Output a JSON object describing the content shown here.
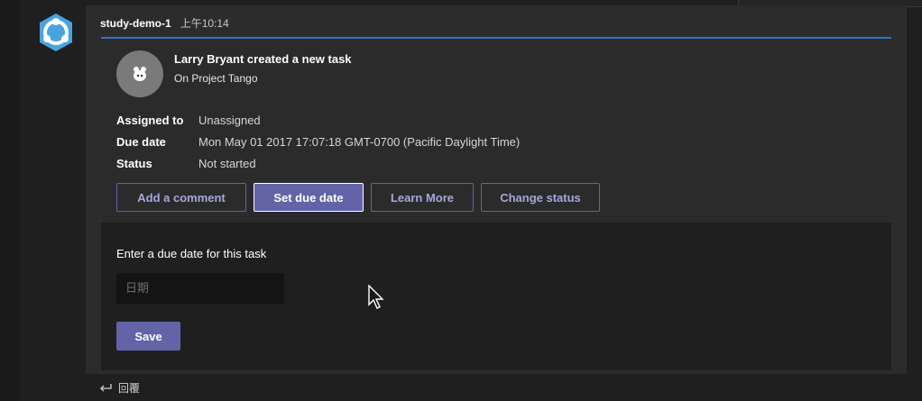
{
  "message": {
    "sender": "study-demo-1",
    "time": "上午10:14"
  },
  "card": {
    "title": "Larry Bryant created a new task",
    "subtitle": "On Project Tango",
    "facts": [
      {
        "label": "Assigned to",
        "value": "Unassigned"
      },
      {
        "label": "Due date",
        "value": "Mon May 01 2017 17:07:18 GMT-0700 (Pacific Daylight Time)"
      },
      {
        "label": "Status",
        "value": "Not started"
      }
    ],
    "actions": [
      {
        "label": "Add a comment"
      },
      {
        "label": "Set due date"
      },
      {
        "label": "Learn More"
      },
      {
        "label": "Change status"
      }
    ]
  },
  "form": {
    "label": "Enter a due date for this task",
    "date_placeholder": "日期",
    "save_label": "Save"
  },
  "reply": {
    "label": "回覆"
  },
  "colors": {
    "accent": "#6264a7",
    "card_top_line": "#2f74c9"
  }
}
